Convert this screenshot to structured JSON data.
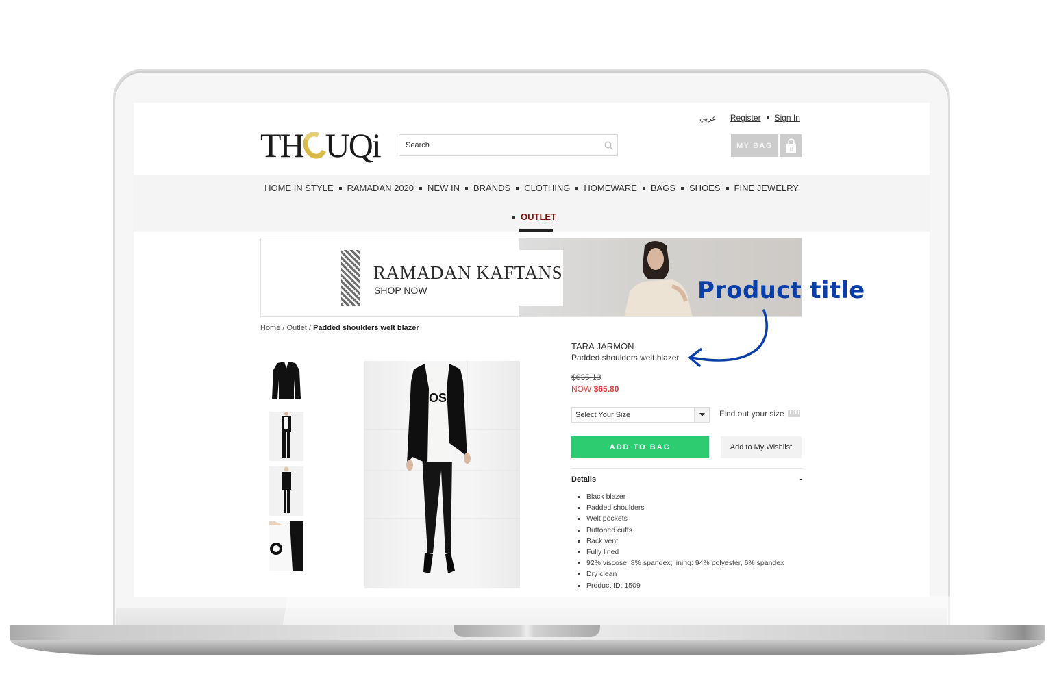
{
  "site": {
    "logo_text": "THOUQi",
    "search_placeholder": "Search",
    "top_links": {
      "arabic": "عربي",
      "register": "Register",
      "sign_in": "Sign In"
    },
    "bag": {
      "label": "MY BAG",
      "count": "0"
    }
  },
  "nav": {
    "items": [
      "HOME IN STYLE",
      "RAMADAN 2020",
      "NEW IN",
      "BRANDS",
      "CLOTHING",
      "HOMEWARE",
      "BAGS",
      "SHOES",
      "FINE JEWELRY"
    ],
    "active": "OUTLET"
  },
  "banner": {
    "title": "RAMADAN KAFTANS",
    "cta": "SHOP NOW"
  },
  "breadcrumb": {
    "home": "Home",
    "sep": " / ",
    "outlet": "Outlet",
    "current": "Padded shoulders welt blazer"
  },
  "product": {
    "brand": "TARA JARMON",
    "name": "Padded shoulders welt blazer",
    "old_price": "$635.13",
    "now_label": "NOW",
    "now_price": "$65.80",
    "size_select": "Select Your Size",
    "find_size": "Find out your size",
    "add_to_bag": "ADD TO BAG",
    "wishlist": "Add to My Wishlist",
    "details_title": "Details",
    "details_toggle": "-",
    "details": [
      "Black blazer",
      "Padded shoulders",
      "Welt pockets",
      "Buttoned cuffs",
      "Back vent",
      "Fully lined",
      "92% viscose, 8% spandex; lining: 94% polyester, 6% spandex",
      "Dry clean",
      "Product ID: 1509"
    ],
    "thumbnail_count": 4
  },
  "annotation": {
    "label": "Product title",
    "color": "#0a3ea8"
  },
  "colors": {
    "accent_green": "#2ecc71",
    "sale_red": "#e63a3a",
    "outlet_red": "#8a0b0b",
    "nav_bg": "#f4f4f4"
  }
}
